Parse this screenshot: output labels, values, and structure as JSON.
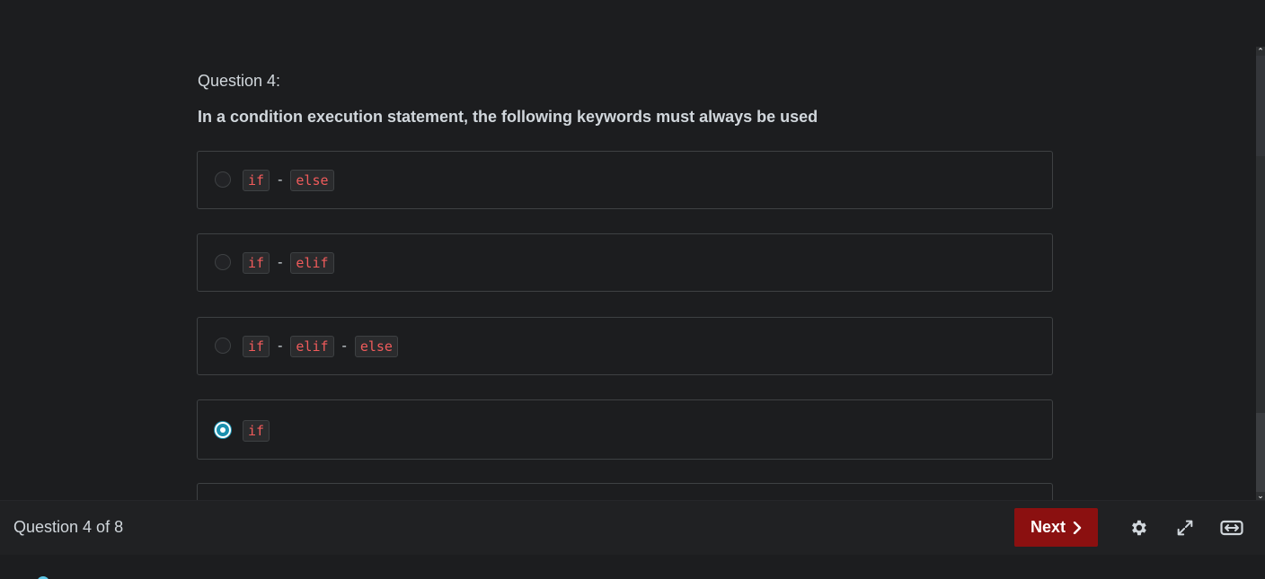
{
  "question": {
    "number_label": "Question 4:",
    "text": "In a condition execution statement, the following keywords must always be used"
  },
  "options": [
    {
      "parts": [
        "if",
        "else"
      ],
      "selected": false
    },
    {
      "parts": [
        "if",
        "elif"
      ],
      "selected": false
    },
    {
      "parts": [
        "if",
        "elif",
        "else"
      ],
      "selected": false
    },
    {
      "parts": [
        "if"
      ],
      "selected": true
    }
  ],
  "separator": "-",
  "footer": {
    "status": "Question 4 of 8",
    "next_label": "Next"
  },
  "icons": {
    "next": "chevron-right-icon",
    "settings": "gear-icon",
    "fullscreen": "expand-icon",
    "widescreen": "widescreen-icon"
  },
  "colors": {
    "background": "#1c1d1f",
    "code_text": "#f05b5b",
    "next_button": "#8b1010",
    "radio_selected": "#1a8fae"
  }
}
